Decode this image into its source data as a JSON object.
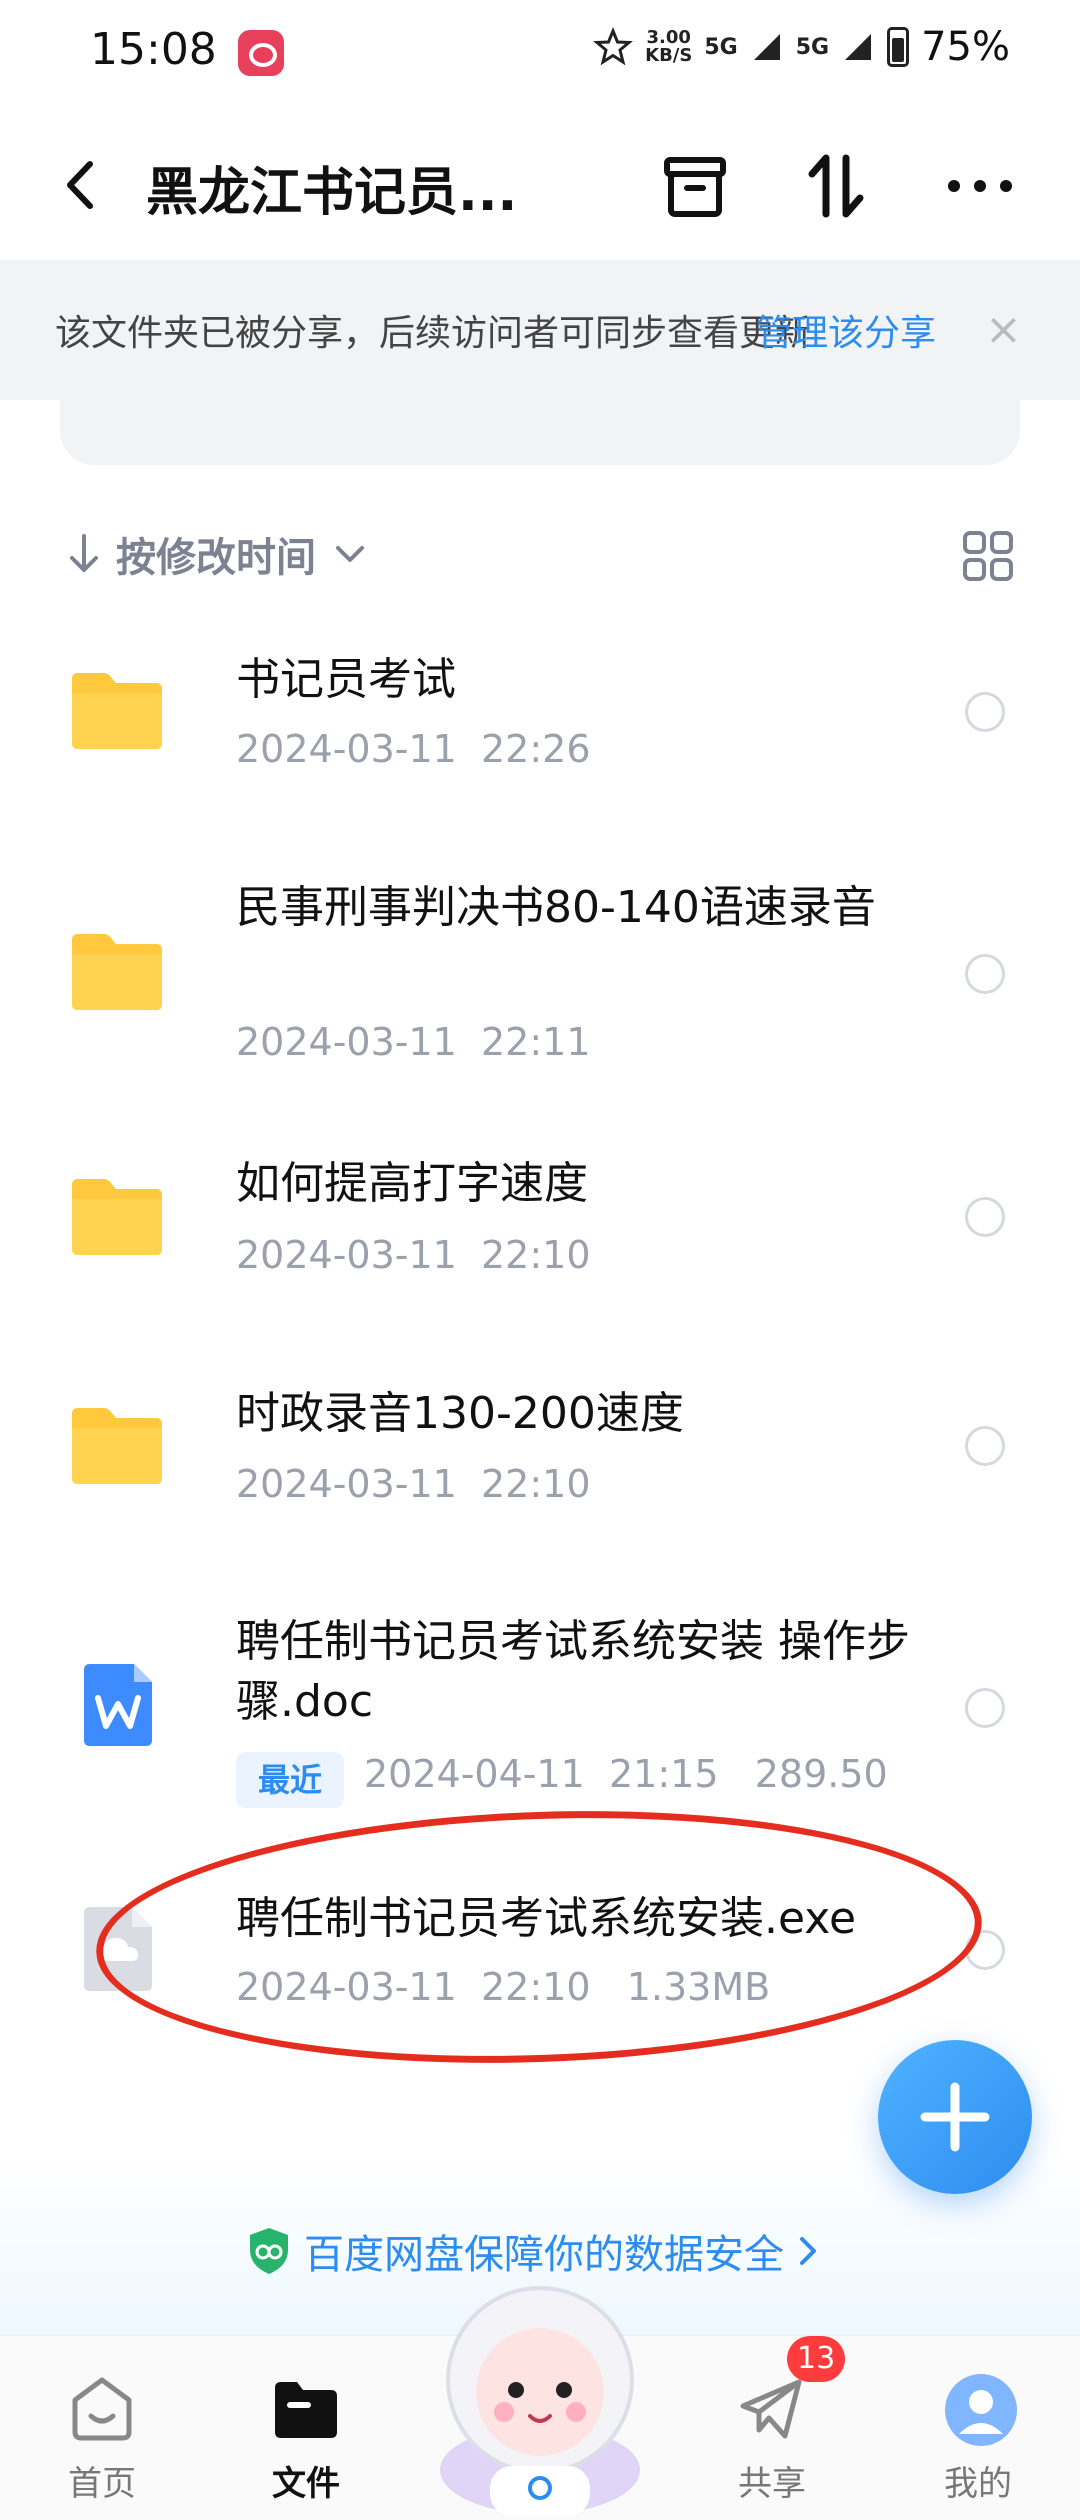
{
  "status_bar": {
    "time": "15:08",
    "speed_value": "3.00",
    "speed_unit": "KB/S",
    "network_1": "5G",
    "network_2": "5G",
    "battery": "75%"
  },
  "header": {
    "title": "黑龙江书记员...",
    "icons": [
      "back-icon",
      "archive-icon",
      "sort-icon",
      "more-icon"
    ]
  },
  "share_banner": {
    "text": "该文件夹已被分享，后续访问者可同步查看更新",
    "link": "管理该分享",
    "close": "×"
  },
  "sort": {
    "label": "按修改时间",
    "view_toggle_icon": "grid-icon"
  },
  "files": [
    {
      "name": "书记员考试",
      "meta": "2024-03-11  22:26",
      "type": "folder"
    },
    {
      "name": "民事刑事判决书80-140语速录音",
      "meta": "2024-03-11  22:11",
      "type": "folder"
    },
    {
      "name": "如何提高打字速度",
      "meta": "2024-03-11  22:10",
      "type": "folder"
    },
    {
      "name": "时政录音130-200速度",
      "meta": "2024-03-11  22:10",
      "type": "folder"
    },
    {
      "name": "聘任制书记员考试系统安装 操作步骤.doc",
      "badge": "最近",
      "meta": "2024-04-11  21:15   289.50",
      "type": "doc"
    },
    {
      "name": "聘任制书记员考试系统安装.exe",
      "meta": "2024-03-11  22:10   1.33MB",
      "type": "exe"
    }
  ],
  "security_text": "百度网盘保障你的数据安全",
  "bottom_nav": {
    "home": "首页",
    "files": "文件",
    "share": "共享",
    "share_badge": "13",
    "mine": "我的"
  },
  "colors": {
    "accent": "#2d8cf0",
    "folder": "#ffc83d",
    "annotation": "#e52d1f"
  }
}
